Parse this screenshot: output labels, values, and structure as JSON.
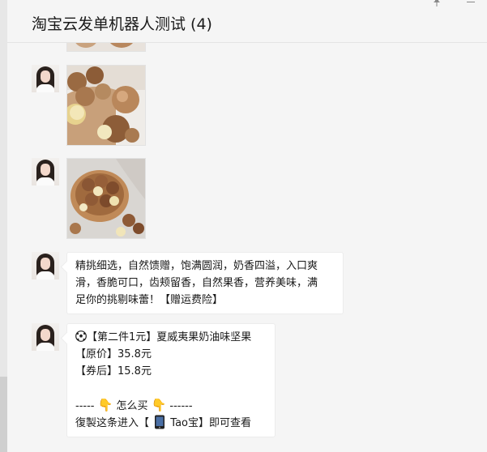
{
  "header": {
    "title": "淘宝云发单机器人测试 (4)"
  },
  "window": {
    "pin_icon": "pin-icon",
    "minimize_icon": "minimize-icon"
  },
  "messages": [
    {
      "type": "image",
      "content": "macadamia-nuts-photo"
    },
    {
      "type": "image",
      "content": "macadamia-nuts-bowl-photo"
    },
    {
      "type": "text",
      "lines": [
        "精挑细选，自然馈赠，饱满圆润，奶香四溢，入口爽",
        "滑，香脆可口，齿颊留香，自然果香，营养美味，满",
        "足你的挑剔味蕾！【赠运费险】"
      ]
    },
    {
      "type": "promo",
      "title": "【第二件1元】夏威夷果奶油味坚果",
      "price_original": "【原价】35.8元",
      "price_coupon": "【券后】15.8元",
      "how_prefix": "-----",
      "how_label": "怎么买",
      "how_suffix": "------",
      "copy_prefix": "復製这条进入【",
      "copy_app": "Tao宝】即可查看"
    }
  ]
}
